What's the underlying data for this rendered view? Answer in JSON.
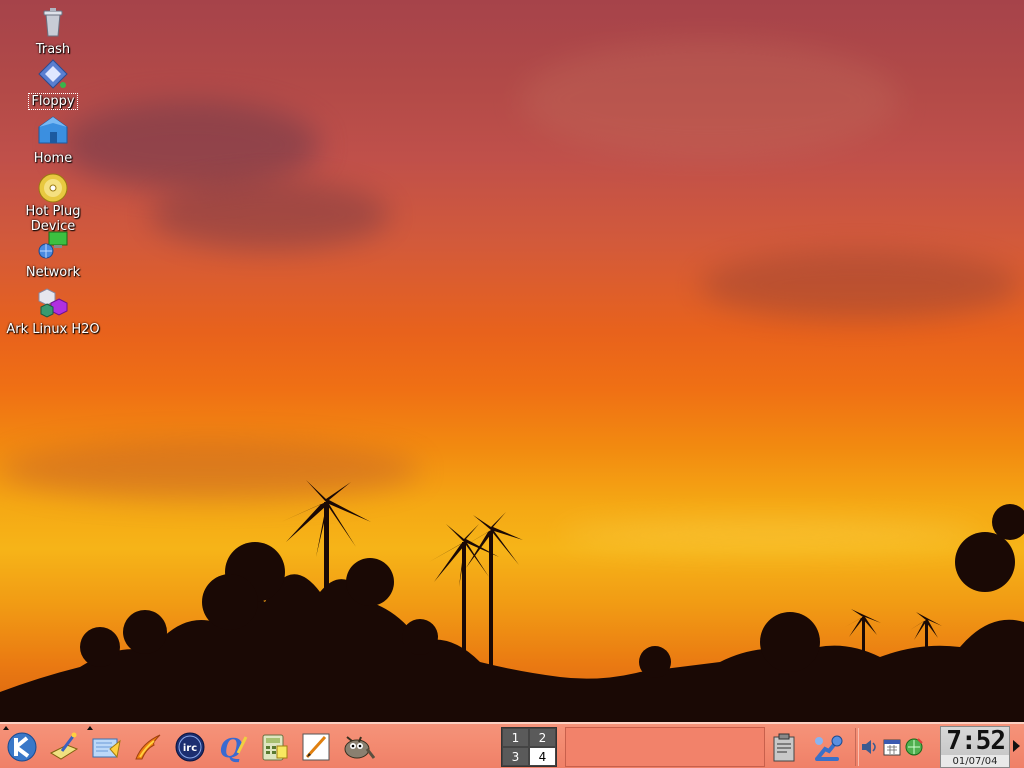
{
  "desktop": {
    "icons": [
      {
        "label": "Trash",
        "icon": "trash-icon"
      },
      {
        "label": "Floppy",
        "icon": "floppy-icon"
      },
      {
        "label": "Home",
        "icon": "home-icon"
      },
      {
        "label": "Hot Plug Device",
        "icon": "cdrom-icon"
      },
      {
        "label": "Network",
        "icon": "network-icon"
      },
      {
        "label": "Ark Linux H2O",
        "icon": "ark-linux-icon"
      }
    ]
  },
  "taskbar": {
    "quick_launch": [
      "k-menu-icon",
      "control-center-icon",
      "file-manager-icon",
      "firebird-browser-icon",
      "irc-client-icon",
      "kopete-icon",
      "calculator-icon",
      "text-editor-icon",
      "gimp-icon"
    ],
    "pager": {
      "desktops": [
        "1",
        "2",
        "3",
        "4"
      ],
      "active": "4"
    },
    "tray": [
      "klipper-icon",
      "kmix-icon",
      "volume-icon",
      "calendar-icon",
      "network-monitor-icon"
    ],
    "clock": {
      "time": "7:52",
      "date": "01/07/04"
    }
  },
  "colors": {
    "taskbar": "#f38a70",
    "pager_active": "#ffffff",
    "pager_inactive": "#5a5a5a"
  }
}
